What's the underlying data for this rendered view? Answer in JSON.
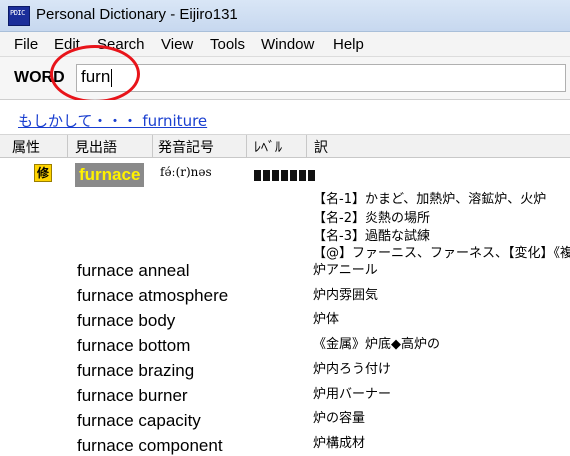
{
  "window": {
    "title": "Personal Dictionary - Eijiro131",
    "icon_text": "PDIC",
    "icon_name": "app-icon"
  },
  "menu": [
    "File",
    "Edit",
    "Search",
    "View",
    "Tools",
    "Window",
    "Help"
  ],
  "search": {
    "label": "WORD",
    "value": "furn"
  },
  "suggestion": {
    "prefix": "もしかして・・・",
    "word": "furniture",
    "text": "もしかして・・・ furniture"
  },
  "columns": [
    "属性",
    "見出語",
    "発音記号",
    "ﾚﾍﾞﾙ",
    "訳"
  ],
  "main_entry": {
    "badge": "修",
    "headword": "furnace",
    "pronunciation": "fə́ː(r)nəs",
    "level_blocks": 7,
    "definitions": [
      "【名-1】かまど、加熱炉、溶鉱炉、火炉",
      "【名-2】炎熱の場所",
      "【名-3】過酷な試練",
      "【@】ファーニス、ファーネス、【変化】《複》"
    ]
  },
  "entries": [
    {
      "word": "furnace anneal",
      "translation": "炉アニール"
    },
    {
      "word": "furnace atmosphere",
      "translation": "炉内雰囲気"
    },
    {
      "word": "furnace body",
      "translation": "炉体"
    },
    {
      "word": "furnace bottom",
      "translation": "《金属》炉底◆高炉の"
    },
    {
      "word": "furnace brazing",
      "translation": "炉内ろう付け"
    },
    {
      "word": "furnace burner",
      "translation": "炉用バーナー"
    },
    {
      "word": "furnace capacity",
      "translation": "炉の容量"
    },
    {
      "word": "furnace component",
      "translation": "炉構成材"
    }
  ],
  "colors": {
    "accent_circle": "#e8141a",
    "link": "#1a3fd0",
    "headword_bg": "#8a8a8a",
    "headword_fg": "#fff200",
    "badge_bg": "#ffd400"
  }
}
